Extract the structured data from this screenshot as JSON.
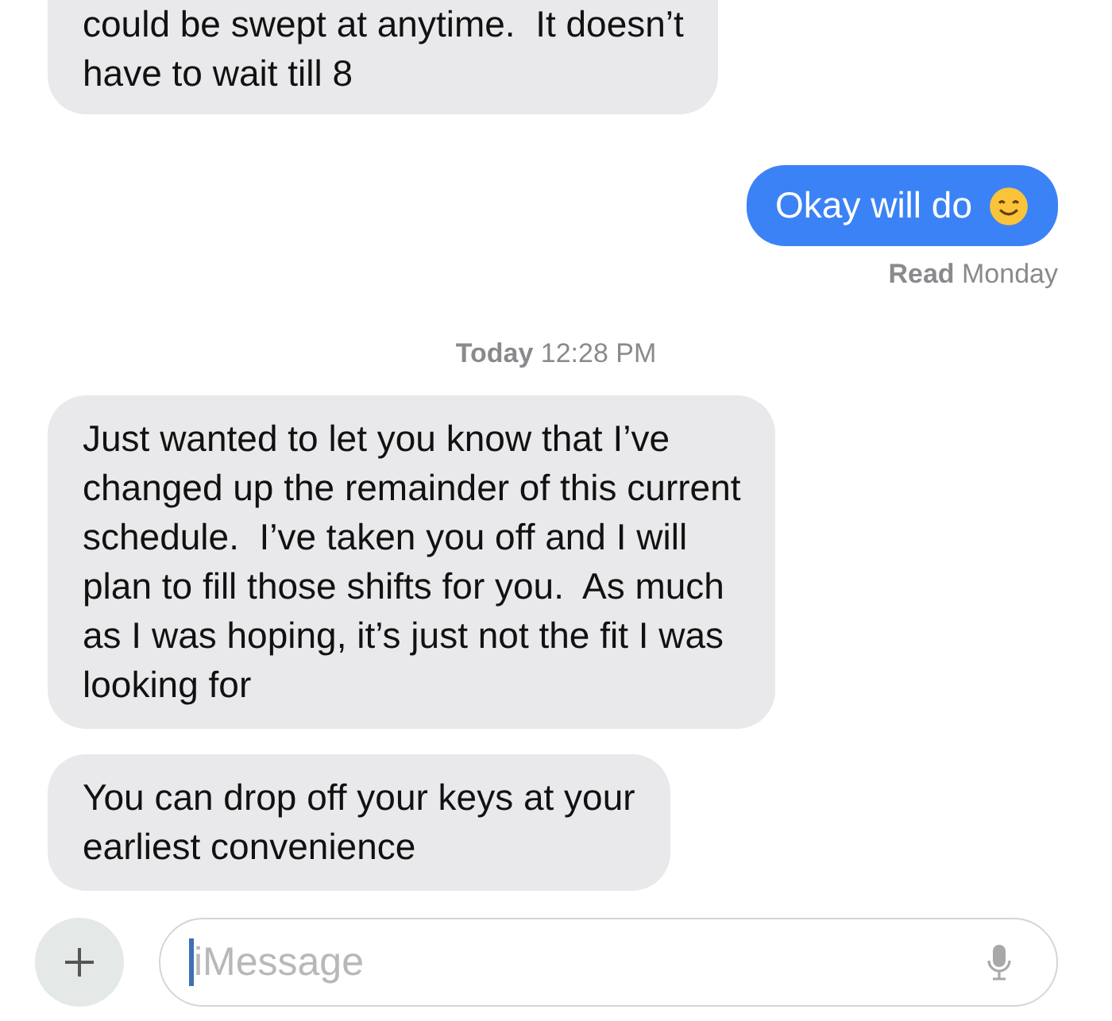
{
  "messages": [
    {
      "kind": "incoming",
      "text": "could be swept at anytime.  It doesn’t\nhave to wait till 8",
      "cut": true
    },
    {
      "kind": "outgoing",
      "text": "Okay will do",
      "emoji": true,
      "receipt": "**Read** Monday"
    },
    {
      "kind": "timestamp",
      "text": "**Today** 12:28 PM"
    },
    {
      "kind": "incoming",
      "text": "Just wanted to let you know that I’ve\nchanged up the remainder of this current\nschedule.  I’ve taken you off and I will\nplan to fill those shifts for you.  As much\nas I was hoping, it’s just not the fit I was\nlooking for"
    },
    {
      "kind": "incoming",
      "text": "You can drop off your keys at your\nearliest convenience"
    }
  ],
  "composer": {
    "placeholder": "iMessage"
  }
}
